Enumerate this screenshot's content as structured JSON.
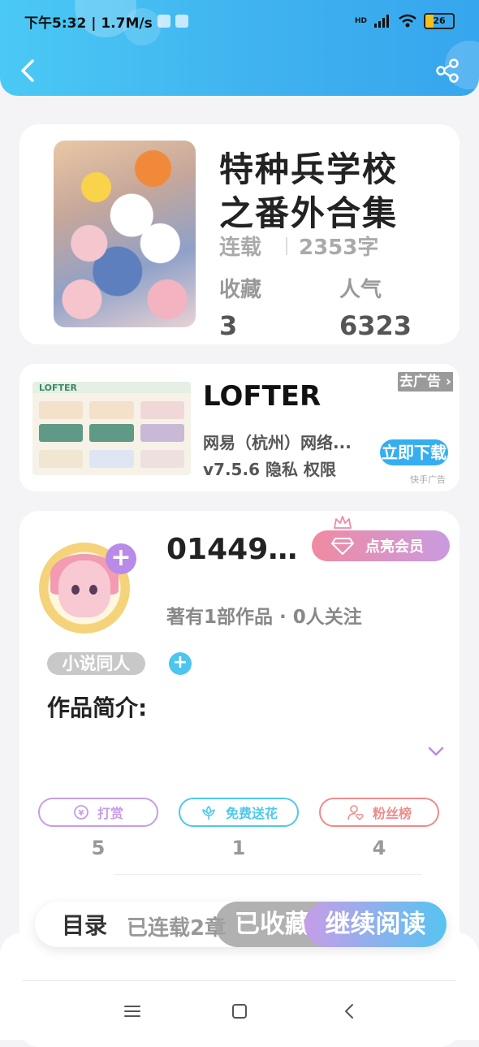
{
  "status_bar": {
    "time_speed": "下午5:32 | 1.7M/s",
    "network": "HD",
    "battery": "26"
  },
  "header": {
    "back_icon": "chevron-left-icon",
    "share_icon": "share-icon"
  },
  "book": {
    "title_line1": "特种兵学校",
    "title_line2": "之番外合集",
    "status": "连载",
    "word_count": "2353字",
    "favorites_label": "收藏",
    "favorites_value": "3",
    "popularity_label": "人气",
    "popularity_value": "6323"
  },
  "ad": {
    "thumb_brand": "LOFTER",
    "app_name": "LOFTER",
    "company": "网易（杭州）网络...",
    "meta": "v7.5.6  隐私  权限",
    "dismiss": "去广告 ›",
    "download": "立即下载",
    "source": "快手广告"
  },
  "author": {
    "name": "014491...",
    "meta": "著有1部作品 · 0人关注",
    "vip_button": "点亮会员",
    "tag": "小说同人",
    "intro_title": "作品简介:"
  },
  "actions": [
    {
      "label": "打赏",
      "count": "5",
      "color": "#c69de8"
    },
    {
      "label": "免费送花",
      "count": "1",
      "color": "#4fc8ec"
    },
    {
      "label": "粉丝榜",
      "count": "4",
      "color": "#ef8b8b"
    }
  ],
  "bottom_bar": {
    "toc_label": "目录",
    "serial_label": "已连载2章",
    "collected": "已收藏",
    "continue_reading": "继续阅读"
  },
  "colors": {
    "header": "#3fb2ef",
    "accent": "#34aef0",
    "vip": "#f08aa1"
  }
}
